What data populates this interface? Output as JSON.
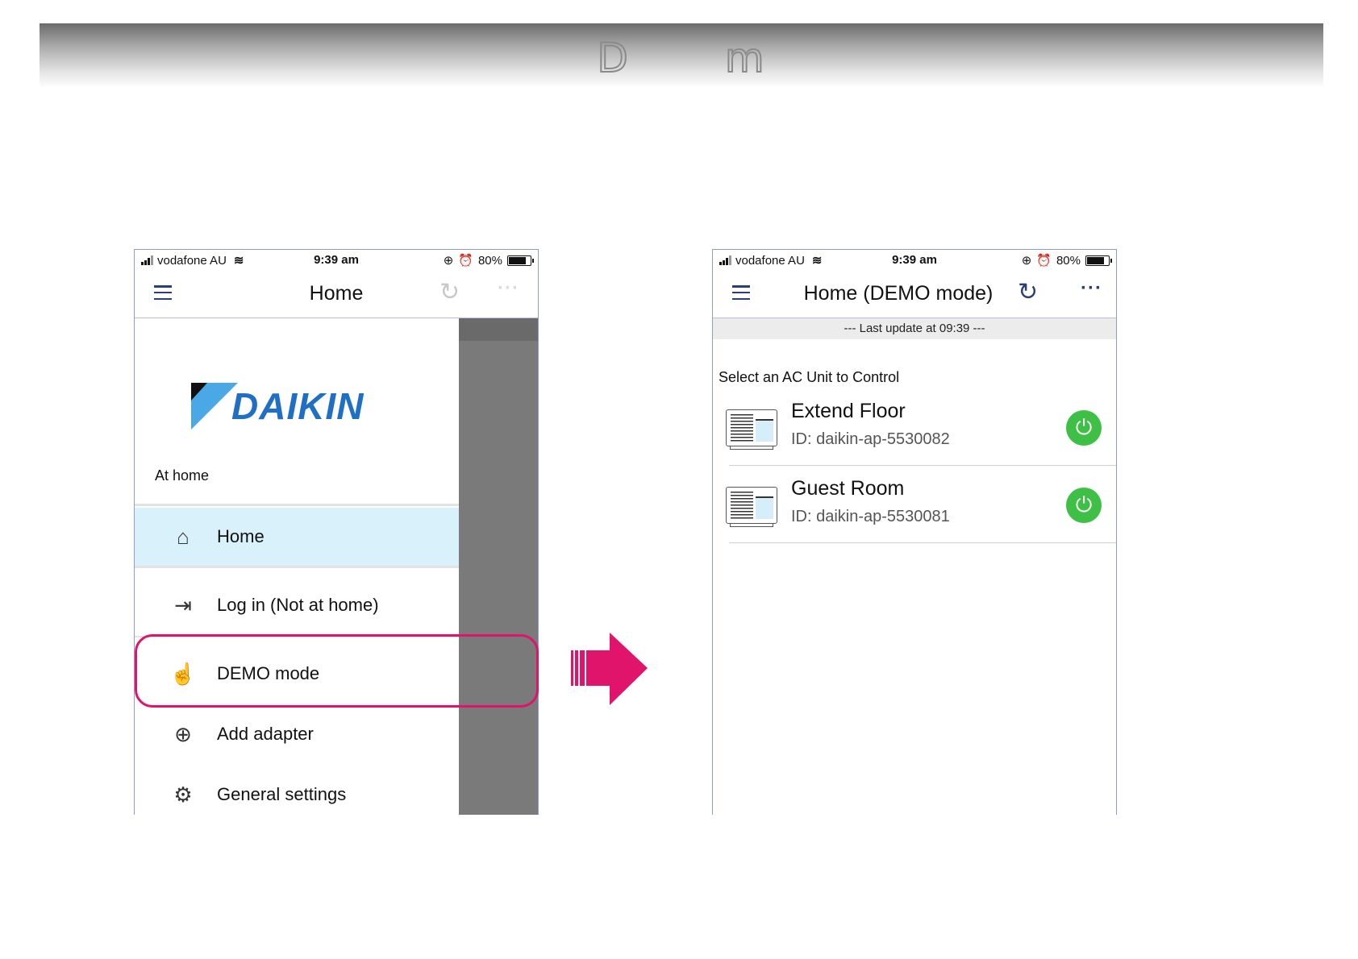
{
  "banner": {
    "title_part1": "D",
    "title_part2": "m"
  },
  "status": {
    "carrier": "vodafone AU",
    "wifi": "wifi-icon",
    "time": "9:39 am",
    "battery": "80%",
    "battery_level": 0.8
  },
  "left_phone": {
    "nav_title": "Home",
    "refresh_icon": "↻",
    "more_icon": "···",
    "logo_text": "DAIKIN",
    "at_home": "At home",
    "menu": [
      {
        "icon": "⌂",
        "label": "Home",
        "active": true
      },
      {
        "icon": "⇥",
        "label": "Log in (Not at home)"
      },
      {
        "icon": "☝",
        "label": "DEMO mode"
      },
      {
        "icon": "⊕",
        "label": "Add adapter"
      },
      {
        "icon": "⚙",
        "label": "General settings"
      }
    ]
  },
  "right_phone": {
    "nav_title": "Home (DEMO mode)",
    "refresh_icon": "↻",
    "more_icon": "···",
    "last_update": "--- Last update at 09:39 ---",
    "select_label": "Select an  AC Unit to Control",
    "units": [
      {
        "name": "Extend Floor",
        "id": "ID: daikin-ap-5530082",
        "power_icon": "⏻"
      },
      {
        "name": "Guest Room",
        "id": "ID: daikin-ap-5530081",
        "power_icon": "⏻"
      }
    ]
  },
  "colors": {
    "accent_pink": "#e0146a",
    "active_item_bg": "#d9f1fb",
    "power_green": "#3ec046",
    "daikin_blue": "#1f6fc5"
  }
}
